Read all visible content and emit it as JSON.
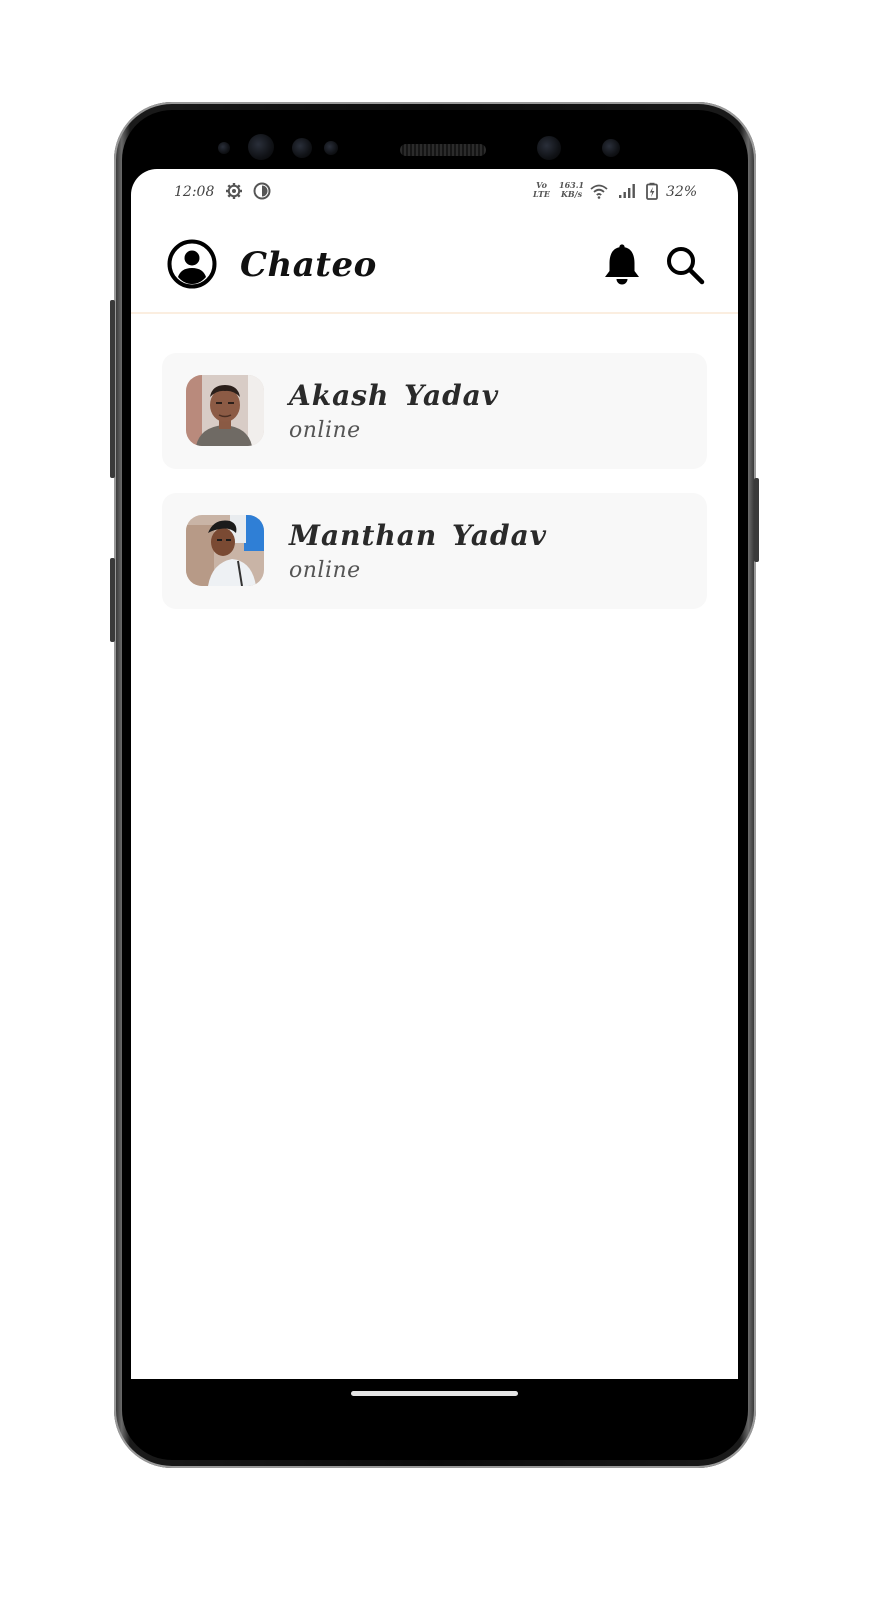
{
  "status_bar": {
    "time": "12:08",
    "network_type_top": "Vo",
    "network_type_bottom": "LTE",
    "speed_value": "163.1",
    "speed_unit": "KB/s",
    "battery": "32%"
  },
  "header": {
    "title": "Chateo"
  },
  "chats": [
    {
      "name": "Akash Yadav",
      "status": "online"
    },
    {
      "name": "Manthan Yadav",
      "status": "online"
    }
  ],
  "colors": {
    "header_divider": "#fbeee0",
    "card_background": "#f8f8f8",
    "title": "#111111"
  },
  "icons": {
    "profile": "account-circle-icon",
    "notifications": "bell-icon",
    "search": "search-icon"
  }
}
